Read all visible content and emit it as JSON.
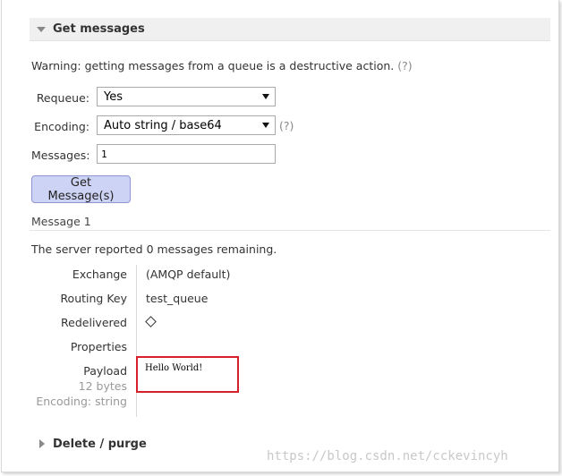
{
  "get_messages": {
    "header": "Get messages",
    "warning": "Warning: getting messages from a queue is a destructive action.",
    "help": "(?)",
    "requeue": {
      "label": "Requeue:",
      "value": "Yes"
    },
    "encoding": {
      "label": "Encoding:",
      "value": "Auto string / base64",
      "help": "(?)"
    },
    "messages": {
      "label": "Messages:",
      "value": "1"
    },
    "button_label": "Get Message(s)"
  },
  "result": {
    "message_title": "Message 1",
    "server_prefix": "The server reported",
    "remaining_count": "0",
    "server_suffix": "messages remaining.",
    "exchange": {
      "label": "Exchange",
      "value": "(AMQP default)"
    },
    "routing_key": {
      "label": "Routing Key",
      "value": "test_queue"
    },
    "redelivered": {
      "label": "Redelivered",
      "value": "○"
    },
    "properties": {
      "label": "Properties"
    },
    "payload": {
      "label": "Payload",
      "size": "12 bytes",
      "encoding": "Encoding: string",
      "value": "Hello World!"
    }
  },
  "delete_purge": {
    "header": "Delete / purge"
  },
  "watermark": "https://blog.csdn.net/cckevincyh",
  "colors": {
    "button_bg": "#cdd3f4",
    "highlight_border": "#d6202a",
    "header_bg": "#f0f0f0"
  }
}
